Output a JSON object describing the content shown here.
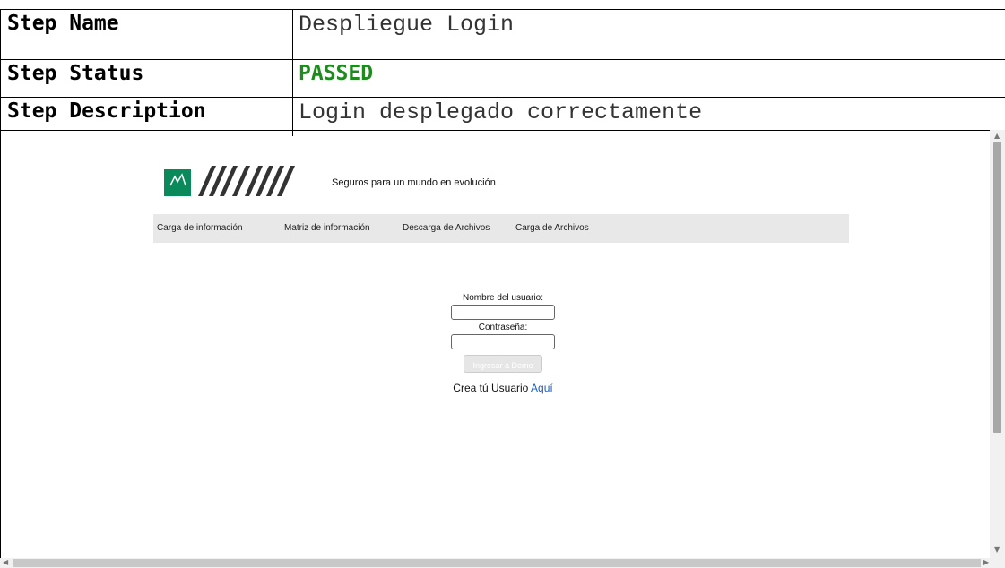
{
  "step": {
    "name_label": "Step Name",
    "name_value": "Despliegue Login",
    "status_label": "Step Status",
    "status_value": "PASSED",
    "description_label": "Step Description",
    "description_value": "Login desplegado correctamente"
  },
  "site": {
    "tagline": "Seguros para un mundo en evolución",
    "nav": [
      "Carga de información",
      "Matriz de información",
      "Descarga de Archivos",
      "Carga de Archivos"
    ]
  },
  "login": {
    "username_label": "Nombre del usuario:",
    "password_label": "Contraseña:",
    "submit_label": "Ingresar a Demo",
    "signup_text": "Crea tú Usuario",
    "signup_link": "Aquí"
  },
  "colors": {
    "passed": "#208a20",
    "link": "#1a5ec6",
    "nav_bg": "#e8e8e8"
  }
}
